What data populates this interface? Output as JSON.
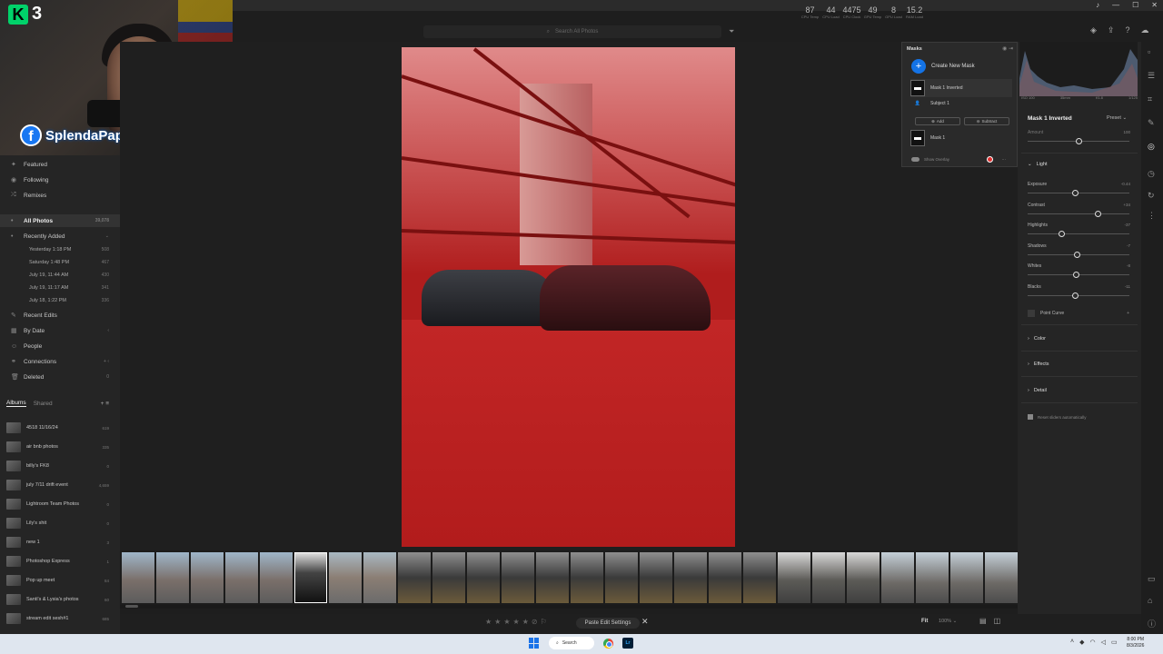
{
  "overlay": {
    "badge_letter": "K",
    "badge_number": "3",
    "fb_letter": "f",
    "fb_name": "SplendaPapi"
  },
  "perf": [
    {
      "value": "87",
      "label": "CPU Temp"
    },
    {
      "value": "44",
      "label": "CPU Load"
    },
    {
      "value": "4475",
      "label": "CPU Clock"
    },
    {
      "value": "49",
      "label": "GPU Temp"
    },
    {
      "value": "8",
      "label": "GPU Load"
    },
    {
      "value": "15.2",
      "label": "RAM Load"
    }
  ],
  "search": {
    "placeholder": "Search All Photos"
  },
  "sidebar": {
    "top_items": [
      {
        "icon": "star-icon",
        "label": "Featured"
      },
      {
        "icon": "rss-icon",
        "label": "Following"
      },
      {
        "icon": "remix-icon",
        "label": "Remixes"
      }
    ],
    "all_photos": {
      "label": "All Photos",
      "count": "39,078"
    },
    "recently_added": {
      "label": "Recently Added"
    },
    "recent_dates": [
      {
        "label": "Yesterday 1:18 PM",
        "count": "508"
      },
      {
        "label": "Saturday 1:48 PM",
        "count": "467"
      },
      {
        "label": "July 19, 11:44 AM",
        "count": "430"
      },
      {
        "label": "July 19, 11:17 AM",
        "count": "341"
      },
      {
        "label": "July 18, 1:22 PM",
        "count": "336"
      }
    ],
    "lower_items": [
      {
        "icon": "recent-edits-icon",
        "label": "Recent Edits",
        "extra": ""
      },
      {
        "icon": "calendar-icon",
        "label": "By Date",
        "extra": "‹"
      },
      {
        "icon": "people-icon",
        "label": "People",
        "extra": ""
      },
      {
        "icon": "connections-icon",
        "label": "Connections",
        "extra": "+ ‹"
      },
      {
        "icon": "trash-icon",
        "label": "Deleted",
        "extra": "0"
      }
    ],
    "albums_tab": "Albums",
    "shared_tab": "Shared",
    "albums": [
      {
        "label": "4518 11/16/24",
        "count": "619"
      },
      {
        "label": "air bnb photos",
        "count": "335"
      },
      {
        "label": "billy's FK8",
        "count": "0"
      },
      {
        "label": "july 7/11 drift event",
        "count": "4,659"
      },
      {
        "label": "Lightroom Team Photos",
        "count": "0"
      },
      {
        "label": "Lily's shit",
        "count": "0"
      },
      {
        "label": "new 1",
        "count": "3"
      },
      {
        "label": "Photoshop Express",
        "count": "1"
      },
      {
        "label": "Pop up meet",
        "count": "84"
      },
      {
        "label": "Santi's & Lysia's photos",
        "count": "60"
      },
      {
        "label": "stream edit sesh#1",
        "count": "685"
      }
    ]
  },
  "masks_panel": {
    "title": "Masks",
    "create_label": "Create New Mask",
    "mask1_inverted": "Mask 1 Inverted",
    "subject": "Subject 1",
    "add_label": "Add",
    "subtract_label": "Subtract",
    "mask1": "Mask 1",
    "show_overlay": "Show Overlay"
  },
  "histogram": {
    "iso": "ISO 100",
    "focal": "35mm",
    "aperture": "f/1.8",
    "shutter": "1/125"
  },
  "adjust": {
    "mask_name": "Mask 1 Inverted",
    "preset": "Preset",
    "amount_label": "Amount",
    "amount_value": "100",
    "amount_level": 0.5,
    "light_section": "Light",
    "sliders": [
      {
        "label": "Exposure",
        "value": "-0.44",
        "level": 0.46
      },
      {
        "label": "Contrast",
        "value": "+34",
        "level": 0.69
      },
      {
        "label": "Highlights",
        "value": "-37",
        "level": 0.33
      },
      {
        "label": "Shadows",
        "value": "-7",
        "level": 0.48
      },
      {
        "label": "Whites",
        "value": "-8",
        "level": 0.47
      },
      {
        "label": "Blacks",
        "value": "-11",
        "level": 0.46
      }
    ],
    "point_curve": "Point Curve",
    "color_section": "Color",
    "effects_section": "Effects",
    "detail_section": "Detail",
    "reset_label": "Reset sliders automatically"
  },
  "bottombar": {
    "paste_label": "Paste Edit Settings",
    "fit_label": "Fit",
    "zoom_label": "100%"
  },
  "taskbar": {
    "search_label": "Search",
    "time": "8:00 PM",
    "date": "8/3/2026",
    "lr_label": "Lr"
  }
}
